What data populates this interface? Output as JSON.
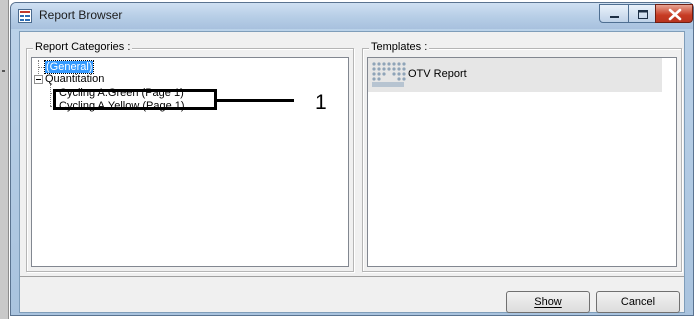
{
  "window": {
    "title": "Report Browser",
    "buttons": {
      "minimize": "minimize",
      "maximize": "maximize",
      "close": "close"
    }
  },
  "categories": {
    "label": "Report Categories :",
    "items": [
      {
        "label": "(General)",
        "selected": true
      },
      {
        "label": "Quantitation",
        "expanded": true
      },
      {
        "label": "Cycling A.Green (Page 1)"
      },
      {
        "label": "Cycling A.Yellow (Page 1)"
      }
    ]
  },
  "templates": {
    "label": "Templates :",
    "items": [
      {
        "label": "OTV Report",
        "icon": "qiagen-logo-icon"
      }
    ]
  },
  "footer": {
    "show_label": "Show",
    "cancel_label": "Cancel"
  },
  "callout": {
    "number": "1"
  },
  "colors": {
    "selection": "#3399ff",
    "close_button": "#c73b23",
    "titlebar": "#b6cde6"
  }
}
